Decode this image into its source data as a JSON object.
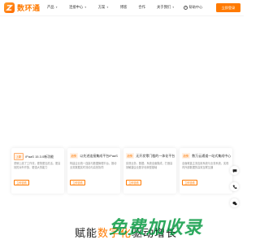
{
  "brand": {
    "logo_text": "数环通",
    "accent": "#ff7a00"
  },
  "nav": {
    "items": [
      {
        "label": "产品",
        "caret": true
      },
      {
        "label": "连接中心",
        "caret": true
      },
      {
        "label": "方案",
        "caret": true
      },
      {
        "label": "博客",
        "caret": false
      },
      {
        "label": "合作",
        "caret": false
      },
      {
        "label": "关于我们",
        "caret": true
      }
    ]
  },
  "header": {
    "help_label": "帮助中心",
    "login_label": "立即登录"
  },
  "cards": [
    {
      "tag": "上新",
      "title": "iPaaS 15.3.0新功能",
      "desc": "重磅上线了工作流，更快更加灵活，更高效的对外开放，更强大的能力",
      "button": "立即查看"
    },
    {
      "tag": "趋势",
      "title": "以先进连接集成平台iPaaS",
      "desc": "构建企业统一连接与数据管理平台，推动业务数据实时流动与高效协同",
      "button": "立即查看"
    },
    {
      "tag": "趋势",
      "title": "无开发零门槛的一体化平台",
      "desc": "实现业务、数据、系统全面集成，打造高效敏捷企业数字化转型基础",
      "button": "立即查看"
    },
    {
      "tag": "趋势",
      "title": "数万云通道一站式集成中心",
      "desc": "全面覆盖主流应用系统与业务系统，实现内外部数据的高效互联互通",
      "button": "立即查看"
    }
  ],
  "bottom": {
    "title_pre": "赋能",
    "title_accent": "数字化",
    "title_post": "驱动增长"
  },
  "watermark": "免费加收录",
  "float_buttons": [
    "chat-icon",
    "phone-icon",
    "wechat-icon"
  ]
}
